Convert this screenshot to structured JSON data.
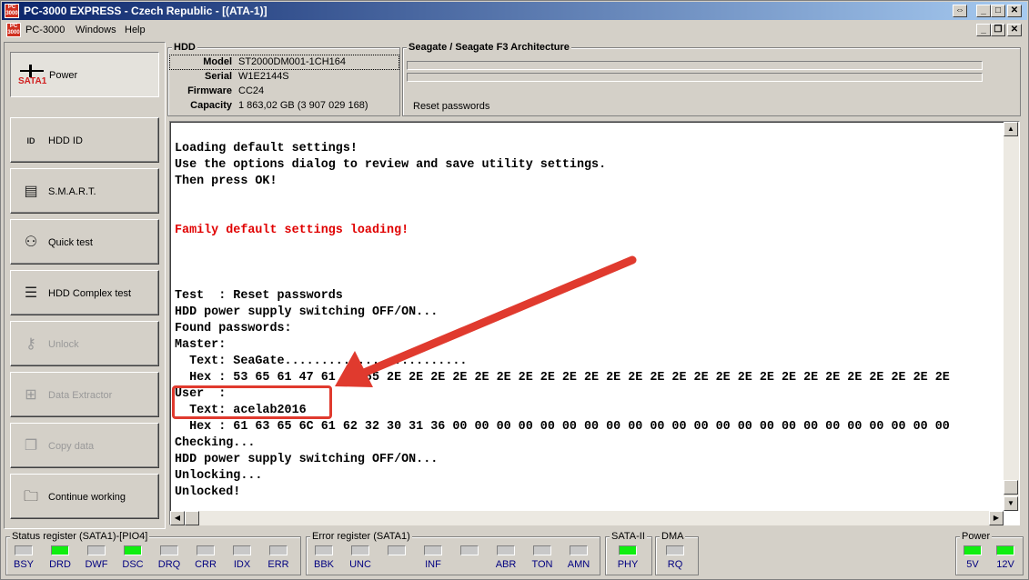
{
  "window": {
    "title": "PC-3000 EXPRESS - Czech Republic - [(ATA-1)]",
    "icon_text": "PC 3000"
  },
  "menu": [
    "PC-3000",
    "Windows",
    "Help"
  ],
  "power": {
    "badge": "SATA1",
    "label": "Power"
  },
  "nav": [
    {
      "label": "HDD ID",
      "icon": "hdd-id-icon",
      "glyph": "ID",
      "disabled": false
    },
    {
      "label": "S.M.A.R.T.",
      "icon": "smart-icon",
      "glyph": "▤",
      "disabled": false
    },
    {
      "label": "Quick test",
      "icon": "quick-test-icon",
      "glyph": "⚇",
      "disabled": false
    },
    {
      "label": "HDD Complex test",
      "icon": "complex-test-icon",
      "glyph": "☰",
      "disabled": false
    },
    {
      "label": "Unlock",
      "icon": "unlock-icon",
      "glyph": "⚷",
      "disabled": true
    },
    {
      "label": "Data Extractor",
      "icon": "data-extractor-icon",
      "glyph": "⊞",
      "disabled": true
    },
    {
      "label": "Copy data",
      "icon": "copy-data-icon",
      "glyph": "❐",
      "disabled": true
    },
    {
      "label": "Continue working",
      "icon": "folder-icon",
      "glyph": "🗀",
      "disabled": false
    }
  ],
  "hdd": {
    "title": "HDD",
    "model_label": "Model",
    "model": "ST2000DM001-1CH164",
    "serial_label": "Serial",
    "serial": "W1E2144S",
    "firmware_label": "Firmware",
    "firmware": "CC24",
    "capacity_label": "Capacity",
    "capacity": "1 863,02 GB (3 907 029 168)"
  },
  "family": {
    "title": "Seagate / Seagate F3 Architecture",
    "current_task": "Reset passwords",
    "progress": [
      0,
      0
    ]
  },
  "log": [
    {
      "text": "",
      "red": false
    },
    {
      "text": "Loading default settings!",
      "red": false
    },
    {
      "text": "Use the options dialog to review and save utility settings.",
      "red": false
    },
    {
      "text": "Then press OK!",
      "red": false
    },
    {
      "text": "",
      "red": false
    },
    {
      "text": "",
      "red": false
    },
    {
      "text": "Family default settings loading!",
      "red": true
    },
    {
      "text": "",
      "red": false
    },
    {
      "text": "",
      "red": false
    },
    {
      "text": "",
      "red": false
    },
    {
      "text": "Test  : Reset passwords",
      "red": false
    },
    {
      "text": "HDD power supply switching OFF/ON...",
      "red": false
    },
    {
      "text": "Found passwords:",
      "red": false
    },
    {
      "text": "Master:",
      "red": false
    },
    {
      "text": "  Text: SeaGate.........................",
      "red": false
    },
    {
      "text": "  Hex : 53 65 61 47 61 74 65 2E 2E 2E 2E 2E 2E 2E 2E 2E 2E 2E 2E 2E 2E 2E 2E 2E 2E 2E 2E 2E 2E 2E 2E 2E 2E",
      "red": false
    },
    {
      "text": "User  :",
      "red": false
    },
    {
      "text": "  Text: acelab2016",
      "red": false
    },
    {
      "text": "  Hex : 61 63 65 6C 61 62 32 30 31 36 00 00 00 00 00 00 00 00 00 00 00 00 00 00 00 00 00 00 00 00 00 00 00",
      "red": false
    },
    {
      "text": "Checking...",
      "red": false
    },
    {
      "text": "HDD power supply switching OFF/ON...",
      "red": false
    },
    {
      "text": "Unlocking...",
      "red": false
    },
    {
      "text": "Unlocked!",
      "red": false
    }
  ],
  "annotation": {
    "color": "#e03a2e"
  },
  "status_register": {
    "title": "Status register (SATA1)-[PIO4]",
    "leds": [
      {
        "label": "BSY",
        "on": false
      },
      {
        "label": "DRD",
        "on": true
      },
      {
        "label": "DWF",
        "on": false
      },
      {
        "label": "DSC",
        "on": true
      },
      {
        "label": "DRQ",
        "on": false
      },
      {
        "label": "CRR",
        "on": false
      },
      {
        "label": "IDX",
        "on": false
      },
      {
        "label": "ERR",
        "on": false
      }
    ]
  },
  "error_register": {
    "title": "Error register (SATA1)",
    "leds": [
      {
        "label": "BBK",
        "on": false
      },
      {
        "label": "UNC",
        "on": false
      },
      {
        "label": "",
        "on": false
      },
      {
        "label": "INF",
        "on": false
      },
      {
        "label": "",
        "on": false
      },
      {
        "label": "ABR",
        "on": false
      },
      {
        "label": "TON",
        "on": false
      },
      {
        "label": "AMN",
        "on": false
      }
    ]
  },
  "sata2": {
    "title": "SATA-II",
    "leds": [
      {
        "label": "PHY",
        "on": true
      }
    ]
  },
  "dma": {
    "title": "DMA",
    "leds": [
      {
        "label": "RQ",
        "on": false
      }
    ]
  },
  "power_panel": {
    "title": "Power",
    "leds": [
      {
        "label": "5V",
        "on": true
      },
      {
        "label": "12V",
        "on": true
      }
    ]
  }
}
